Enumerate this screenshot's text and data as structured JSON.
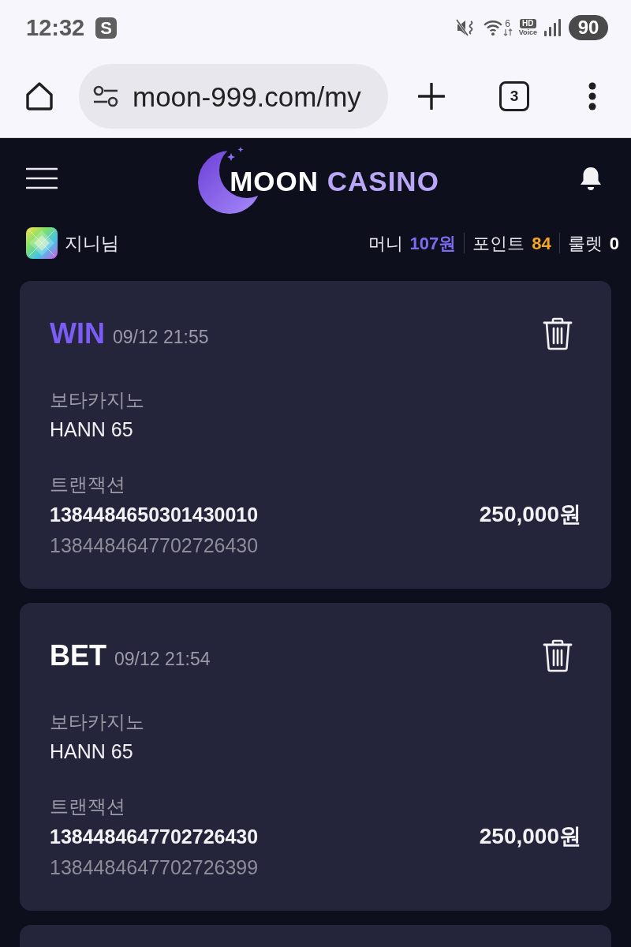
{
  "status_bar": {
    "time": "12:32",
    "app_badge": "S",
    "network_type": "6",
    "voice_badge": "HD",
    "voice_label": "Voice",
    "battery": "90"
  },
  "browser": {
    "url": "moon-999.com/my",
    "tab_count": "3"
  },
  "header": {
    "logo": [
      "MOON",
      "CASINO"
    ]
  },
  "user": {
    "name": "지니님",
    "stats": [
      {
        "label": "머니",
        "value": "107원",
        "color": "#7b6cf0"
      },
      {
        "label": "포인트",
        "value": "84",
        "color": "#f5a524"
      },
      {
        "label": "룰렛",
        "value": "0",
        "color": "#ffffff"
      }
    ]
  },
  "transactions": {
    "items": [
      {
        "kind": "win",
        "type": "WIN",
        "time": "09/12 21:55",
        "provider": "보타카지노",
        "game": "HANN 65",
        "transaction_label": "트랜잭션",
        "transaction_id": "1384484650301430010",
        "reference_id": "1384484647702726430",
        "amount": "250,000원"
      },
      {
        "kind": "bet",
        "type": "BET",
        "time": "09/12 21:54",
        "provider": "보타카지노",
        "game": "HANN 65",
        "transaction_label": "트랜잭션",
        "transaction_id": "1384484647702726430",
        "reference_id": "1384484647702726399",
        "amount": "250,000원"
      }
    ],
    "more_below": true
  }
}
